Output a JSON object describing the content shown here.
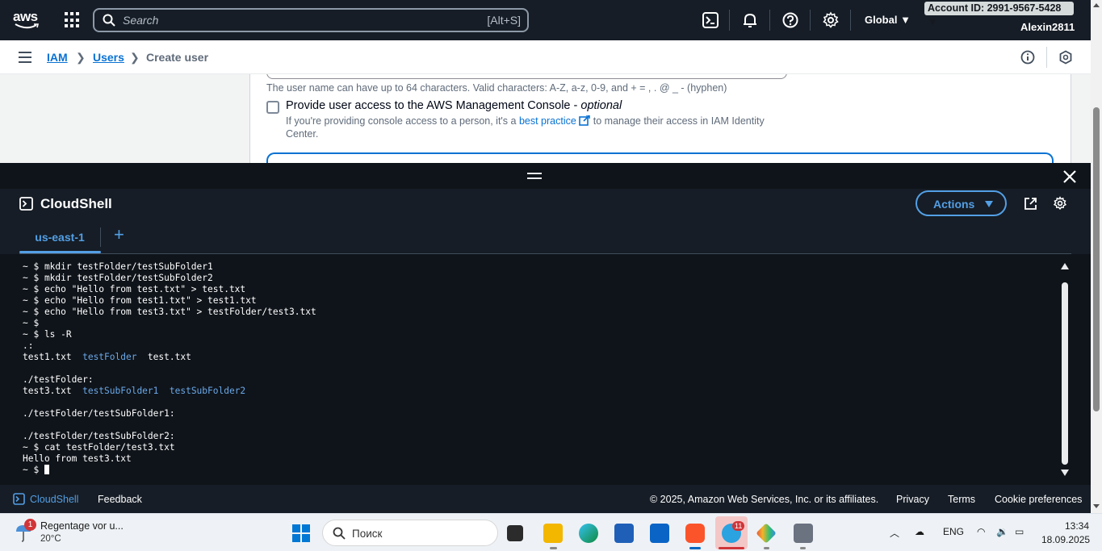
{
  "topnav": {
    "logo_text": "aws",
    "search_placeholder": "Search",
    "search_shortcut": "[Alt+S]",
    "region": "Global",
    "account": "Account ID: 2991-9567-5428",
    "user": "Alexin2811"
  },
  "breadcrumb": {
    "items": [
      "IAM",
      "Users",
      "Create user"
    ]
  },
  "form": {
    "username_hint": "The user name can have up to 64 characters. Valid characters: A-Z, a-z, 0-9, and + = , . @ _ - (hyphen)",
    "console_access_label": "Provide user access to the AWS Management Console",
    "console_access_optional": "optional",
    "console_access_desc_before": "If you're providing console access to a person, it's a ",
    "console_access_desc_link": "best practice",
    "console_access_desc_after": " to manage their access in IAM Identity Center."
  },
  "cloudshell": {
    "title": "CloudShell",
    "actions_label": "Actions",
    "tab_label": "us-east-1",
    "add_tab": "+",
    "lines": [
      {
        "text": "~ $ mkdir testFolder/testSubFolder1"
      },
      {
        "text": "~ $ mkdir testFolder/testSubFolder2"
      },
      {
        "text": "~ $ echo \"Hello from test.txt\" > test.txt"
      },
      {
        "text": "~ $ echo \"Hello from test1.txt\" > test1.txt"
      },
      {
        "text": "~ $ echo \"Hello from test3.txt\" > testFolder/test3.txt"
      },
      {
        "text": "~ $"
      },
      {
        "text": "~ $ ls -R"
      },
      {
        "text": ".:"
      },
      {
        "parts": [
          {
            "t": "test1.txt  "
          },
          {
            "t": "testFolder",
            "dir": true
          },
          {
            "t": "  test.txt"
          }
        ]
      },
      {
        "text": ""
      },
      {
        "text": "./testFolder:"
      },
      {
        "parts": [
          {
            "t": "test3.txt  "
          },
          {
            "t": "testSubFolder1",
            "dir": true
          },
          {
            "t": "  "
          },
          {
            "t": "testSubFolder2",
            "dir": true
          }
        ]
      },
      {
        "text": ""
      },
      {
        "text": "./testFolder/testSubFolder1:"
      },
      {
        "text": ""
      },
      {
        "text": "./testFolder/testSubFolder2:"
      },
      {
        "text": "~ $ cat testFolder/test3.txt"
      },
      {
        "text": "Hello from test3.txt"
      },
      {
        "text": "~ $ ",
        "cursor": true
      }
    ]
  },
  "footer": {
    "cloudshell": "CloudShell",
    "feedback": "Feedback",
    "copyright": "© 2025, Amazon Web Services, Inc. or its affiliates.",
    "privacy": "Privacy",
    "terms": "Terms",
    "cookies": "Cookie preferences"
  },
  "taskbar": {
    "weather_badge": "1",
    "weather_title": "Regentage vor u...",
    "weather_temp": "20°C",
    "search_placeholder": "Поиск",
    "telegram_badge": "11",
    "lang": "ENG",
    "time": "13:34",
    "date": "18.09.2025"
  },
  "colors": {
    "nav_bg": "#161d26",
    "accent_blue": "#539fe5",
    "link_blue": "#0972d3",
    "terminal_bg": "#0f141a",
    "dir_color": "#6aa8e8"
  }
}
